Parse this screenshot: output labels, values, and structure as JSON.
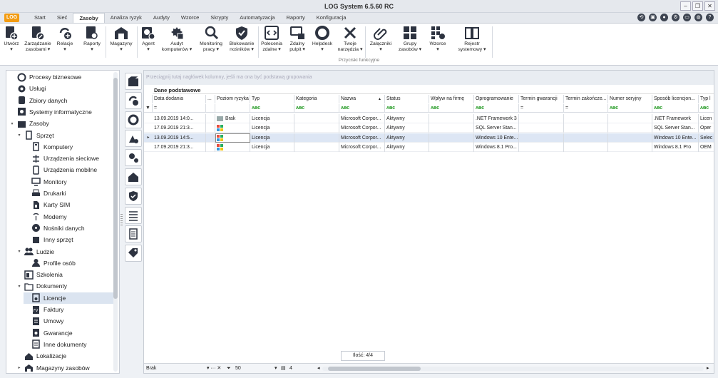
{
  "window": {
    "title": "LOG System 6.5.60 RC",
    "controls": [
      "–",
      "❐",
      "✕"
    ]
  },
  "logo": {
    "text": "LOG"
  },
  "menu_tabs": [
    "Start",
    "Sieć",
    "Zasoby",
    "Analiza ryzyk",
    "Audyty",
    "Wzorce",
    "Skrypty",
    "Automatyzacja",
    "Raporty",
    "Konfiguracja"
  ],
  "active_tab": "Zasoby",
  "ribbon": {
    "buttons": [
      {
        "label": "Utwórz\n▾",
        "icon": "create-icon"
      },
      {
        "label": "Zarządzanie\nzasobami ▾",
        "icon": "manage-icon"
      },
      {
        "label": "Relacje\n▾",
        "icon": "relations-icon"
      },
      {
        "label": "Raporty\n▾",
        "icon": "report-icon"
      },
      {
        "label": "Magazyny\n▾",
        "icon": "warehouse-icon"
      },
      {
        "label": "Agent\n▾",
        "icon": "agent-icon"
      },
      {
        "label": "Audyt\nkomputerów ▾",
        "icon": "audit-icon"
      },
      {
        "label": "Monitoring\npracy ▾",
        "icon": "monitoring-icon"
      },
      {
        "label": "Blokowanie\nnośników ▾",
        "icon": "shield-icon"
      },
      {
        "label": "Polecenia\nzdalne ▾",
        "icon": "code-icon"
      },
      {
        "label": "Zdalny\npulpit ▾",
        "icon": "remote-desktop-icon"
      },
      {
        "label": "Helpdesk\n▾",
        "icon": "lifebuoy-icon"
      },
      {
        "label": "Twoje\nnarzędzia ▾",
        "icon": "tools-icon"
      },
      {
        "label": "Załączniki\n▾",
        "icon": "paperclip-icon"
      },
      {
        "label": "Grupy\nzasobów ▾",
        "icon": "groups-icon"
      },
      {
        "label": "Wzorce\n▾",
        "icon": "templates-icon"
      },
      {
        "label": "Rejestr\nsystemowy ▾",
        "icon": "book-icon"
      }
    ],
    "group_label": "Przyciski funkcyjne"
  },
  "tree": [
    {
      "label": "Procesy biznesowe",
      "icon": "process-icon",
      "level": 0,
      "expander": ""
    },
    {
      "label": "Usługi",
      "icon": "gear-icon",
      "level": 0,
      "expander": ""
    },
    {
      "label": "Zbiory danych",
      "icon": "database-icon",
      "level": 0,
      "expander": ""
    },
    {
      "label": "Systemy informatyczne",
      "icon": "system-icon",
      "level": 0,
      "expander": ""
    },
    {
      "label": "Zasoby",
      "icon": "box-icon",
      "level": 0,
      "expander": "▾"
    },
    {
      "label": "Sprzęt",
      "icon": "hardware-icon",
      "level": 1,
      "expander": "▾"
    },
    {
      "label": "Komputery",
      "icon": "computer-icon",
      "level": 2,
      "expander": ""
    },
    {
      "label": "Urządzenia sieciowe",
      "icon": "network-icon",
      "level": 2,
      "expander": ""
    },
    {
      "label": "Urządzenia mobilne",
      "icon": "mobile-icon",
      "level": 2,
      "expander": ""
    },
    {
      "label": "Monitory",
      "icon": "monitor-icon",
      "level": 2,
      "expander": ""
    },
    {
      "label": "Drukarki",
      "icon": "printer-icon",
      "level": 2,
      "expander": ""
    },
    {
      "label": "Karty SIM",
      "icon": "sim-icon",
      "level": 2,
      "expander": ""
    },
    {
      "label": "Modemy",
      "icon": "modem-icon",
      "level": 2,
      "expander": ""
    },
    {
      "label": "Nośniki danych",
      "icon": "disc-icon",
      "level": 2,
      "expander": ""
    },
    {
      "label": "Inny sprzęt",
      "icon": "other-hw-icon",
      "level": 2,
      "expander": ""
    },
    {
      "label": "Ludzie",
      "icon": "people-icon",
      "level": 1,
      "expander": "▾"
    },
    {
      "label": "Profile osób",
      "icon": "person-icon",
      "level": 2,
      "expander": ""
    },
    {
      "label": "Szkolenia",
      "icon": "training-icon",
      "level": 1,
      "expander": ""
    },
    {
      "label": "Dokumenty",
      "icon": "folder-icon",
      "level": 1,
      "expander": "▾"
    },
    {
      "label": "Licencje",
      "icon": "license-icon",
      "level": 2,
      "expander": ""
    },
    {
      "label": "Faktury",
      "icon": "invoice-icon",
      "level": 2,
      "expander": ""
    },
    {
      "label": "Umowy",
      "icon": "contract-icon",
      "level": 2,
      "expander": ""
    },
    {
      "label": "Gwarancje",
      "icon": "warranty-icon",
      "level": 2,
      "expander": ""
    },
    {
      "label": "Inne dokumenty",
      "icon": "document-icon",
      "level": 2,
      "expander": ""
    },
    {
      "label": "Lokalizacje",
      "icon": "home-icon",
      "level": 1,
      "expander": ""
    },
    {
      "label": "Magazyny zasobów",
      "icon": "warehouse-icon",
      "level": 1,
      "expander": "▸"
    }
  ],
  "selected_tree_item": "Licencje",
  "grid": {
    "group_hint": "Przeciągnij tutaj nagłówek kolumny, jeśli ma ona być podstawą grupowania",
    "band": "Dane podstawowe",
    "columns": [
      "Data dodania",
      "...",
      "Poziom ryzyka",
      "Typ",
      "Kategoria",
      "Nazwa",
      "Status",
      "Wpływ na firmę",
      "Oprogramowanie",
      "Termin gwarancji",
      "Termin zakończe...",
      "Numer seryjny",
      "Sposób licencjon...",
      "Typ l"
    ],
    "sorted_column": "Nazwa",
    "filter_cells": [
      "=",
      "",
      "",
      "ᴀᴃᴄ",
      "ᴀᴃᴄ",
      "ᴀᴃᴄ",
      "ᴀᴃᴄ",
      "ᴀᴃᴄ",
      "ᴀᴃᴄ",
      "=",
      "=",
      "ᴀᴃᴄ",
      "ᴀᴃᴄ",
      "ᴀᴃᴄ"
    ],
    "rows": [
      {
        "cells": [
          "13.09.2019 14:0...",
          "",
          "Brak",
          "Licencja",
          "",
          "Microsoft Corpor...",
          "Aktywny",
          "",
          ".NET Framework 3",
          "",
          "",
          "",
          ".NET Framework",
          "Licen"
        ],
        "current": false
      },
      {
        "cells": [
          "17.09.2019 21:3...",
          "",
          "",
          "Licencja",
          "",
          "Microsoft Corpor...",
          "Aktywny",
          "",
          "SQL Server Stan...",
          "",
          "",
          "",
          "SQL Server Stan...",
          "Oper"
        ],
        "current": false
      },
      {
        "cells": [
          "13.09.2019 14:5...",
          "",
          "",
          "Licencja",
          "",
          "Microsoft Corpor...",
          "Aktywny",
          "",
          "Windows 10 Ente...",
          "",
          "",
          "",
          "Windows 10 Ente...",
          "Selec"
        ],
        "current": true
      },
      {
        "cells": [
          "17.09.2019 21:3...",
          "",
          "",
          "Licencja",
          "",
          "Microsoft Corpor...",
          "Aktywny",
          "",
          "Windows 8.1 Pro...",
          "",
          "",
          "",
          "Windows 8.1 Pro",
          "OEM"
        ],
        "current": false
      }
    ],
    "summary": "Ilość: 4/4"
  },
  "statusbar": {
    "filter_value": "Brak",
    "page_size": "50",
    "page": "4"
  },
  "colors": {
    "accent": "#2d3340",
    "selection": "#dbe4f0",
    "filter_green": "#2a9d2a",
    "logo": "#f39c12"
  }
}
